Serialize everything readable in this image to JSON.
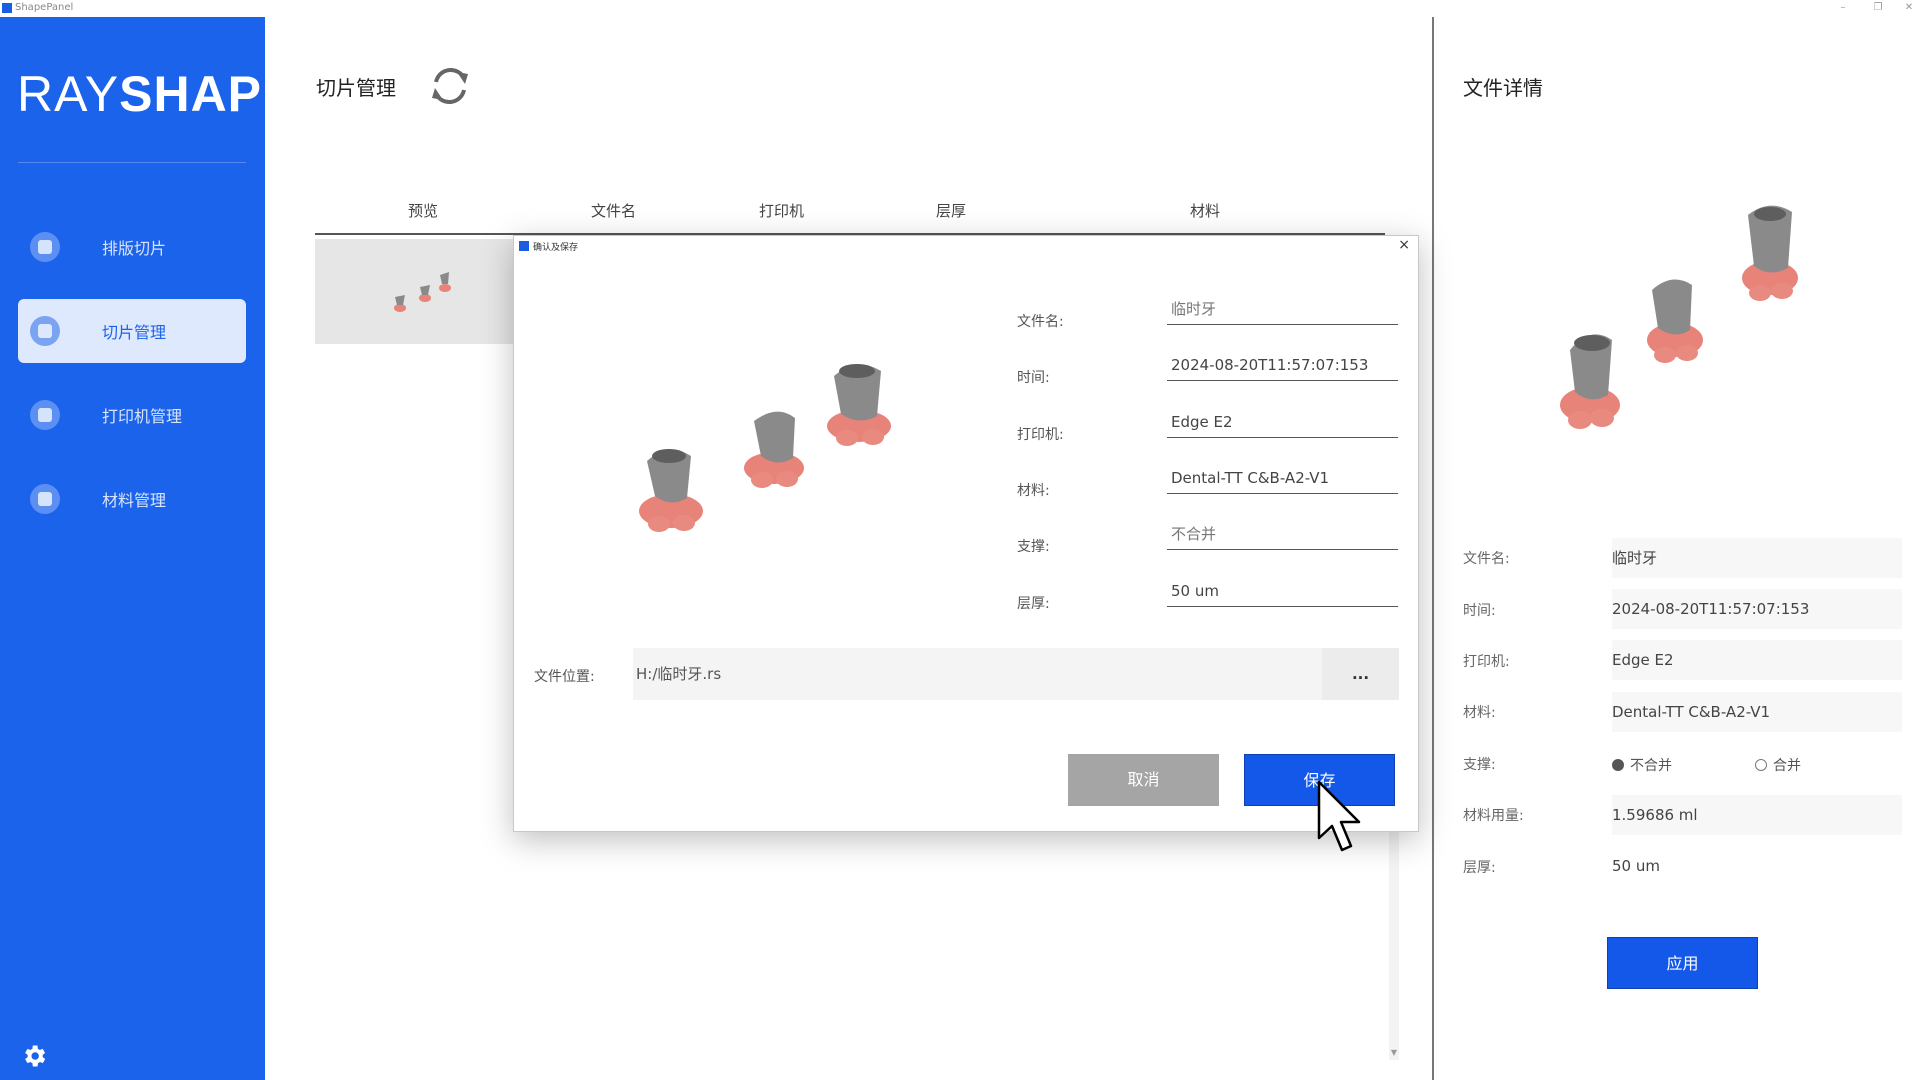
{
  "window": {
    "title": "ShapePanel",
    "minimize": "–",
    "restore": "❐",
    "close": "✕"
  },
  "sidebar": {
    "logo_light": "RAY",
    "logo_bold": "SHAPE",
    "items": [
      {
        "label": "排版切片",
        "icon": "layout-slice-icon"
      },
      {
        "label": "切片管理",
        "icon": "slice-manage-icon"
      },
      {
        "label": "打印机管理",
        "icon": "printer-manage-icon"
      },
      {
        "label": "材料管理",
        "icon": "material-manage-icon"
      }
    ],
    "active_index": 1,
    "settings_icon": "gear-icon"
  },
  "main": {
    "title": "切片管理",
    "refresh_icon": "refresh-icon",
    "columns": [
      "预览",
      "文件名",
      "打印机",
      "层厚",
      "材料"
    ]
  },
  "dialog": {
    "title": "确认及保存",
    "close": "×",
    "fields": [
      {
        "label": "文件名:",
        "value": "临时牙"
      },
      {
        "label": "时间:",
        "value": "2024-08-20T11:57:07:153"
      },
      {
        "label": "打印机:",
        "value": "Edge E2"
      },
      {
        "label": "材料:",
        "value": "Dental-TT C&B-A2-V1"
      },
      {
        "label": "支撑:",
        "value": "不合并"
      },
      {
        "label": "层厚:",
        "value": "50 um"
      }
    ],
    "location_label": "文件位置:",
    "location_value": "H:/临时牙.rs",
    "browse_label": "...",
    "cancel_label": "取消",
    "save_label": "保存"
  },
  "detail": {
    "title": "文件详情",
    "rows": [
      {
        "label": "文件名:",
        "value": "临时牙"
      },
      {
        "label": "时间:",
        "value": "2024-08-20T11:57:07:153"
      },
      {
        "label": "打印机:",
        "value": "Edge E2"
      },
      {
        "label": "材料:",
        "value": "Dental-TT C&B-A2-V1"
      },
      {
        "label": "支撑:",
        "value": ""
      },
      {
        "label": "材料用量:",
        "value": "1.59686 ml"
      },
      {
        "label": "层厚:",
        "value": "50 um"
      }
    ],
    "support_options": [
      {
        "label": "不合并",
        "selected": true
      },
      {
        "label": "合并",
        "selected": false
      }
    ],
    "apply_label": "应用"
  },
  "colors": {
    "brand": "#1b63ea",
    "primary_button": "#1358e8",
    "cancel_button": "#a5a5a5",
    "model_gray": "#8a8a8a",
    "model_support": "#e8837a"
  }
}
